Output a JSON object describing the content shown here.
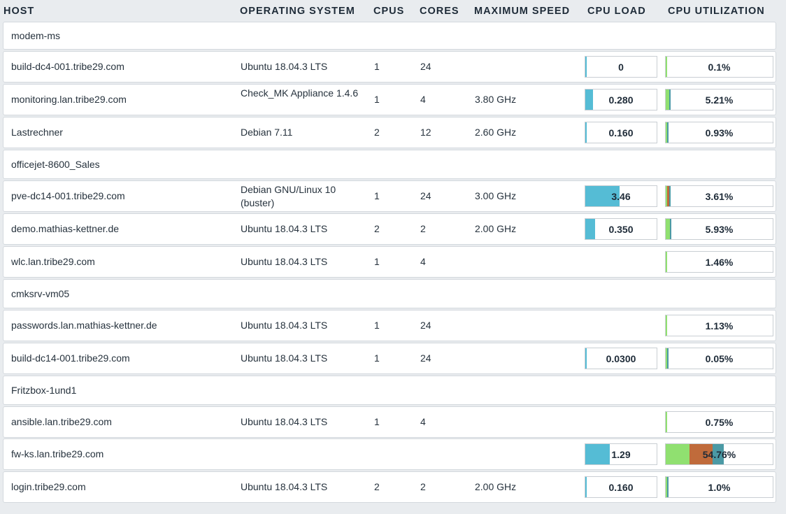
{
  "columns": {
    "host": "HOST",
    "os": "OPERATING SYSTEM",
    "cpus": "CPUS",
    "cores": "CORES",
    "max_speed": "MAXIMUM SPEED",
    "cpu_load": "CPU LOAD",
    "cpu_util": "CPU UTILIZATION"
  },
  "colors": {
    "load": "#55bcd5",
    "util_user": "#90e070",
    "util_system": "#c06b3b",
    "util_wait": "#4b9aa5"
  },
  "rows": [
    {
      "host": "modem-ms"
    },
    {
      "host": "build-dc4-001.tribe29.com",
      "os": "Ubuntu 18.04.3 LTS",
      "cpus": "1",
      "cores": "24",
      "load": "0",
      "load_frac": 0,
      "util": "0.1%",
      "util_parts": [
        0.001,
        0,
        0
      ]
    },
    {
      "host": "monitoring.lan.tribe29.com",
      "os": "Check_MK Appliance 1.4.6",
      "cpus": "1",
      "cores": "4",
      "speed": "3.80 GHz",
      "load": "0.280",
      "load_frac": 0.11,
      "util": "5.21%",
      "util_parts": [
        0.03,
        0,
        0.01
      ]
    },
    {
      "host": "Lastrechner",
      "os": "Debian 7.11",
      "cpus": "2",
      "cores": "12",
      "speed": "2.60 GHz",
      "load": "0.160",
      "load_frac": 0.02,
      "util": "0.93%",
      "util_parts": [
        0.01,
        0,
        0.005
      ]
    },
    {
      "host": "officejet-8600_Sales"
    },
    {
      "host": "pve-dc14-001.tribe29.com",
      "os": "Debian GNU/Linux 10 (buster)",
      "cpus": "1",
      "cores": "24",
      "speed": "3.00 GHz",
      "load": "3.46",
      "load_frac": 0.48,
      "util": "3.61%",
      "util_parts": [
        0.005,
        0.02,
        0.005
      ]
    },
    {
      "host": "demo.mathias-kettner.de",
      "os": "Ubuntu 18.04.3 LTS",
      "cpus": "2",
      "cores": "2",
      "speed": "2.00 GHz",
      "load": "0.350",
      "load_frac": 0.14,
      "util": "5.93%",
      "util_parts": [
        0.04,
        0,
        0.01
      ]
    },
    {
      "host": "wlc.lan.tribe29.com",
      "os": "Ubuntu 18.04.3 LTS",
      "cpus": "1",
      "cores": "4",
      "util": "1.46%",
      "util_parts": [
        0.005,
        0,
        0
      ]
    },
    {
      "host": "cmksrv-vm05"
    },
    {
      "host": "passwords.lan.mathias-kettner.de",
      "os": "Ubuntu 18.04.3 LTS",
      "cpus": "1",
      "cores": "24",
      "util": "1.13%",
      "util_parts": [
        0.005,
        0,
        0
      ]
    },
    {
      "host": "build-dc14-001.tribe29.com",
      "os": "Ubuntu 18.04.3 LTS",
      "cpus": "1",
      "cores": "24",
      "load": "0.0300",
      "load_frac": 0.02,
      "util": "0.05%",
      "util_parts": [
        0.005,
        0,
        0.005
      ]
    },
    {
      "host": "Fritzbox-1und1"
    },
    {
      "host": "ansible.lan.tribe29.com",
      "os": "Ubuntu 18.04.3 LTS",
      "cpus": "1",
      "cores": "4",
      "util": "0.75%",
      "util_parts": [
        0.005,
        0,
        0
      ]
    },
    {
      "host": "fw-ks.lan.tribe29.com",
      "load": "1.29",
      "load_frac": 0.34,
      "util": "54.76%",
      "util_parts": [
        0.22,
        0.22,
        0.1
      ]
    },
    {
      "host": "login.tribe29.com",
      "os": "Ubuntu 18.04.3 LTS",
      "cpus": "2",
      "cores": "2",
      "speed": "2.00 GHz",
      "load": "0.160",
      "load_frac": 0.02,
      "util": "1.0%",
      "util_parts": [
        0.005,
        0,
        0.01
      ]
    }
  ]
}
